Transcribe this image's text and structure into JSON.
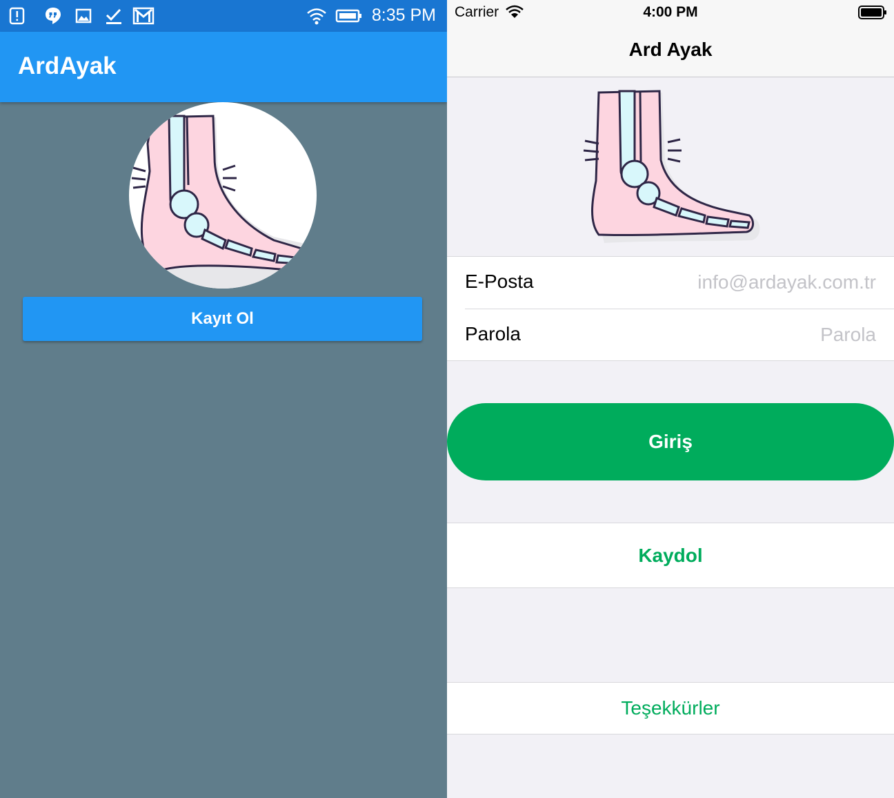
{
  "android": {
    "status_bar": {
      "time": "8:35 PM",
      "icons": [
        "alert-icon",
        "hangouts-icon",
        "image-icon",
        "checkmark-icon",
        "gmail-icon",
        "wifi-icon",
        "battery-icon"
      ]
    },
    "app_bar": {
      "title": "ArdAyak"
    },
    "illustration": "foot-xray-illustration",
    "register_button": {
      "label": "Kayıt Ol"
    }
  },
  "ios": {
    "status_bar": {
      "carrier": "Carrier",
      "time": "4:00 PM",
      "icons": [
        "wifi-icon",
        "battery-icon"
      ]
    },
    "nav_bar": {
      "title": "Ard Ayak"
    },
    "illustration": "foot-xray-illustration",
    "form": {
      "email_label": "E-Posta",
      "email_placeholder": "info@ardayak.com.tr",
      "password_label": "Parola",
      "password_placeholder": "Parola"
    },
    "login_button": {
      "label": "Giriş"
    },
    "register_button": {
      "label": "Kaydol"
    },
    "thanks_button": {
      "label": "Teşekkürler"
    }
  },
  "colors": {
    "android_status": "#1976d2",
    "android_primary": "#2196f3",
    "android_background": "#607d8b",
    "ios_accent": "#00ac5c",
    "ios_background": "#f2f1f6"
  }
}
